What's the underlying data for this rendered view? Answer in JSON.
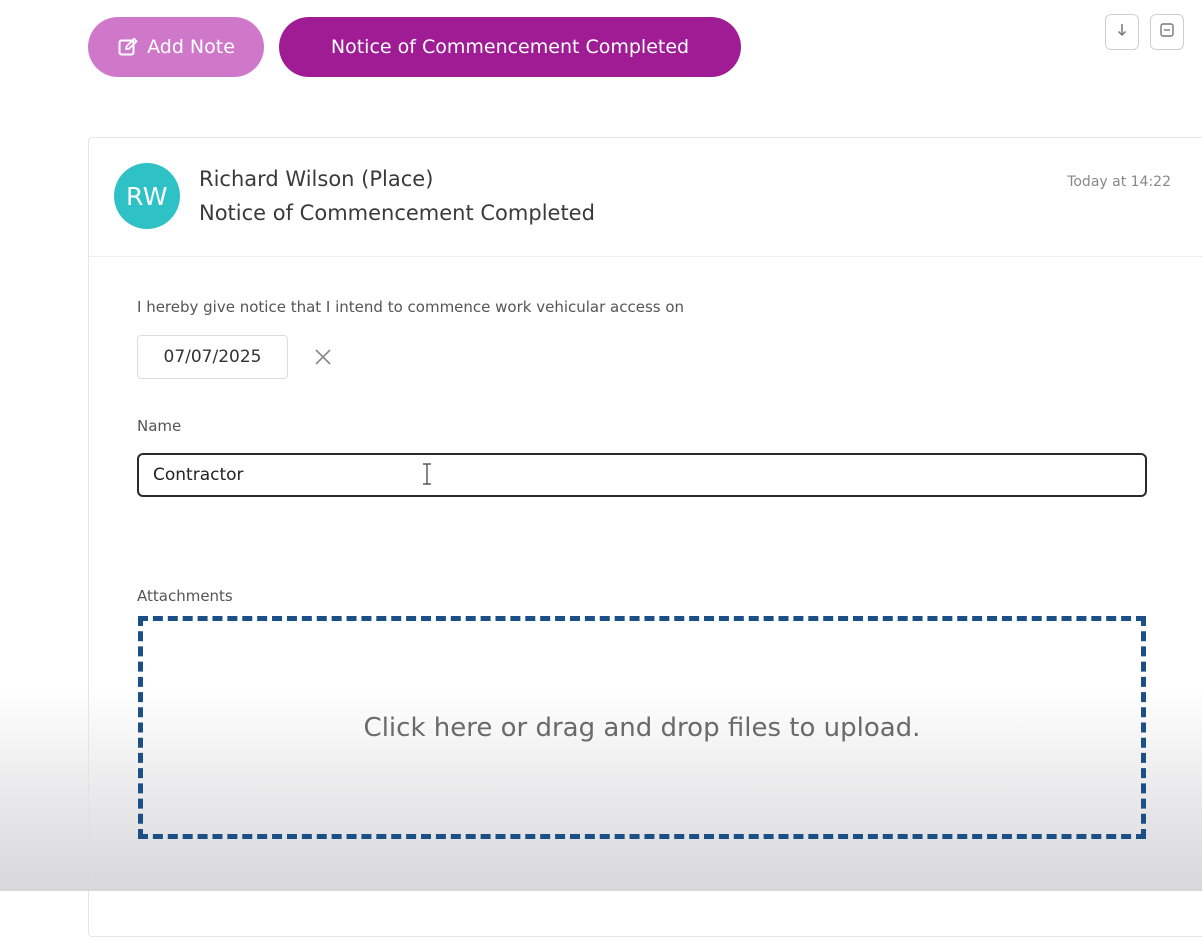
{
  "toolbar": {
    "add_note_label": "Add Note",
    "add_note_icon": "edit-note-icon",
    "status_label": "Notice of Commencement Completed",
    "download_icon": "arrow-down-icon",
    "collapse_icon": "collapse-icon"
  },
  "note": {
    "avatar_initials": "RW",
    "author": "Richard Wilson (Place)",
    "subject": "Notice of Commencement Completed",
    "timestamp": "Today at 14:22"
  },
  "form": {
    "notice_text": "I hereby give notice that I intend to commence work vehicular access on",
    "date_value": "07/07/2025",
    "clear_icon": "close-icon",
    "name_label": "Name",
    "name_value": "Contractor",
    "attachments_label": "Attachments",
    "dropzone_text": "Click here or drag and drop files to upload."
  },
  "colors": {
    "add_note_bg": "#cf78c9",
    "status_bg": "#a01c95",
    "avatar_bg": "#2ec1c6",
    "dropzone_border": "#1c4f86"
  }
}
